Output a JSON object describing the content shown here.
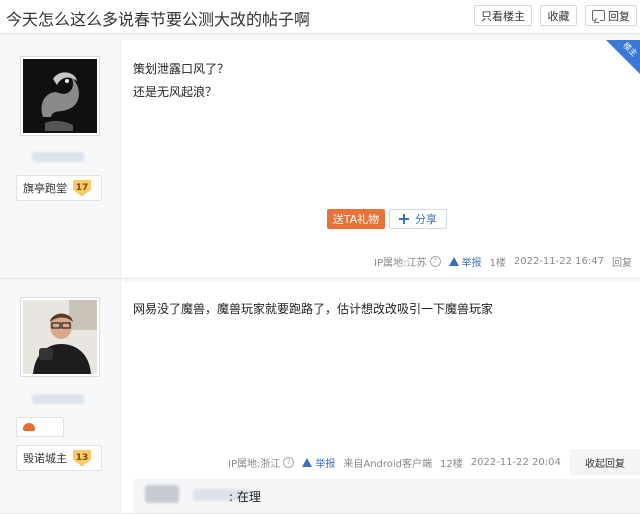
{
  "header": {
    "title": "今天怎么这么多说春节要公测大改的帖子啊",
    "only_op": "只看楼主",
    "favorite": "收藏",
    "reply": "回复"
  },
  "post1": {
    "op_tag": "楼主",
    "badge_name": "旗亭跑堂",
    "badge_level": "17",
    "lines": [
      "策划泄露口风了？",
      "还是无风起浪？"
    ],
    "gift_label": "送TA礼物",
    "share_label": "分享",
    "ip": "IP属地:江苏",
    "report": "举报",
    "floor": "1楼",
    "time": "2022-11-22 16:47",
    "reply": "回复"
  },
  "post2": {
    "badge_name": "毁诺城主",
    "badge_level": "13",
    "text": "网易没了魔兽，魔兽玩家就要跑路了，估计想改改吸引一下魔兽玩家",
    "ip": "IP属地:浙江",
    "report": "举报",
    "client": "来自Android客户端",
    "floor": "12楼",
    "time": "2022-11-22 20:04",
    "collapse": "收起回复",
    "sub_reply": ": 在理"
  },
  "colors": {
    "accent": "#3a78d8",
    "gift": "#e8723a",
    "link": "#3a6fc0"
  }
}
